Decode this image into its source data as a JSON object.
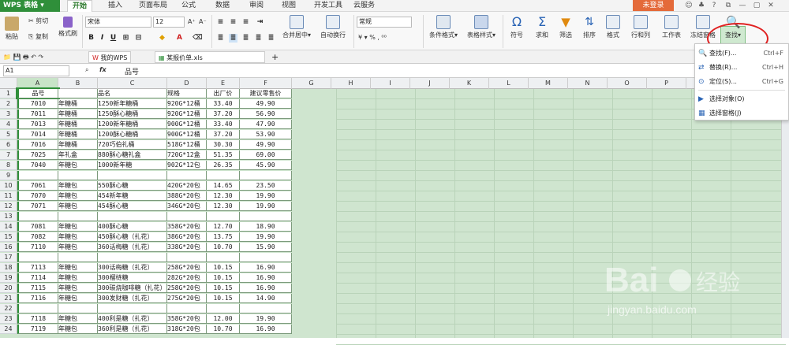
{
  "app": {
    "name": "WPS 表格",
    "login": "未登录"
  },
  "menu": {
    "tabs": [
      "开始",
      "插入",
      "页面布局",
      "公式",
      "数据",
      "审阅",
      "视图",
      "开发工具",
      "云服务"
    ]
  },
  "ribbon": {
    "paste": "粘贴",
    "cut": "剪切",
    "copy": "复制",
    "format_painter": "格式刷",
    "font_name": "宋体",
    "font_size": "12",
    "merge_center": "合并居中",
    "wrap_text": "自动换行",
    "number_format": "常规",
    "cond_format": "条件格式",
    "table_style": "表格样式",
    "symbol": "符号",
    "sum": "求和",
    "filter": "筛选",
    "sort": "排序",
    "format": "格式",
    "row_col": "行和列",
    "worksheet": "工作表",
    "freeze": "冻结窗格",
    "find": "查找"
  },
  "doc_tabs": {
    "wps": "我的WPS",
    "file": "某报价单.xls"
  },
  "formula_bar": {
    "cell_ref": "A1",
    "fx": "fx",
    "value": "品号"
  },
  "columns": [
    "A",
    "B",
    "C",
    "D",
    "E",
    "F",
    "G",
    "H",
    "I",
    "J",
    "K",
    "L",
    "M",
    "N",
    "O",
    "P"
  ],
  "rows": [
    [
      "1",
      "品号",
      "",
      "品名",
      "规格",
      "出厂价",
      "建议零售价"
    ],
    [
      "2",
      "7010",
      "年糖桶",
      "1250新年糖桶",
      "920G*12桶",
      "33.40",
      "49.90"
    ],
    [
      "3",
      "7011",
      "年糖桶",
      "1250酥心糖桶",
      "920G*12桶",
      "37.20",
      "56.90"
    ],
    [
      "4",
      "7013",
      "年糖桶",
      "1200新年糖桶",
      "900G*12桶",
      "33.40",
      "47.90"
    ],
    [
      "5",
      "7014",
      "年糖桶",
      "1200酥心糖桶",
      "900G*12桶",
      "37.20",
      "53.90"
    ],
    [
      "6",
      "7016",
      "年糖桶",
      "720巧伯礼桶",
      "518G*12桶",
      "30.30",
      "49.90"
    ],
    [
      "7",
      "7025",
      "年礼盒",
      "880酥心糖礼盒",
      "720G*12盒",
      "51.35",
      "69.00"
    ],
    [
      "8",
      "7040",
      "年糖包",
      "1000新年糖",
      "902G*12包",
      "26.35",
      "45.90"
    ],
    [
      "9",
      "",
      "",
      "",
      "",
      "",
      ""
    ],
    [
      "10",
      "7061",
      "年糖包",
      "550酥心糖",
      "420G*20包",
      "14.65",
      "23.50"
    ],
    [
      "11",
      "7070",
      "年糖包",
      "454新年糖",
      "388G*20包",
      "12.30",
      "19.90"
    ],
    [
      "12",
      "7071",
      "年糖包",
      "454酥心糖",
      "346G*20包",
      "12.30",
      "19.90"
    ],
    [
      "13",
      "",
      "",
      "",
      "",
      "",
      ""
    ],
    [
      "14",
      "7081",
      "年糖包",
      "400酥心糖",
      "358G*20包",
      "12.70",
      "18.90"
    ],
    [
      "15",
      "7082",
      "年糖包",
      "450酥心糖（扎花）",
      "386G*20包",
      "13.75",
      "19.90"
    ],
    [
      "16",
      "7110",
      "年糖包",
      "360话梅糖（扎花）",
      "338G*20包",
      "10.70",
      "15.90"
    ],
    [
      "17",
      "",
      "",
      "",
      "",
      "",
      ""
    ],
    [
      "18",
      "7113",
      "年糖包",
      "300话梅糖（扎花）",
      "258G*20包",
      "10.15",
      "16.90"
    ],
    [
      "19",
      "7114",
      "年糖包",
      "300榴梿糖",
      "282G*20包",
      "10.15",
      "16.90"
    ],
    [
      "20",
      "7115",
      "年糖包",
      "300碳烧咖啡糖（扎花）",
      "258G*20包",
      "10.15",
      "16.90"
    ],
    [
      "21",
      "7116",
      "年糖包",
      "300发财糖（扎花）",
      "275G*20包",
      "10.15",
      "14.90"
    ],
    [
      "22",
      "",
      "",
      "",
      "",
      "",
      ""
    ],
    [
      "23",
      "7118",
      "年糖包",
      "400利是糖（扎花）",
      "358G*20包",
      "12.00",
      "19.90"
    ],
    [
      "24",
      "7119",
      "年糖包",
      "360利是糖（扎花）",
      "318G*20包",
      "10.70",
      "16.90"
    ]
  ],
  "dropdown": [
    {
      "label": "查找(F)...",
      "shortcut": "Ctrl+F"
    },
    {
      "label": "替换(R)...",
      "shortcut": "Ctrl+H"
    },
    {
      "label": "定位(S)...",
      "shortcut": "Ctrl+G"
    },
    {
      "label": "选择对象(O)",
      "shortcut": ""
    },
    {
      "label": "选择窗格(J)",
      "shortcut": ""
    }
  ],
  "watermark": {
    "brand": "Bai",
    "brand2": "经验",
    "url": "jingyan.baidu.com"
  },
  "colors": {
    "accent": "#2f8f3a",
    "grid_bg": "#cfe5cf",
    "highlight": "#e02020",
    "login": "#e46a3a"
  }
}
